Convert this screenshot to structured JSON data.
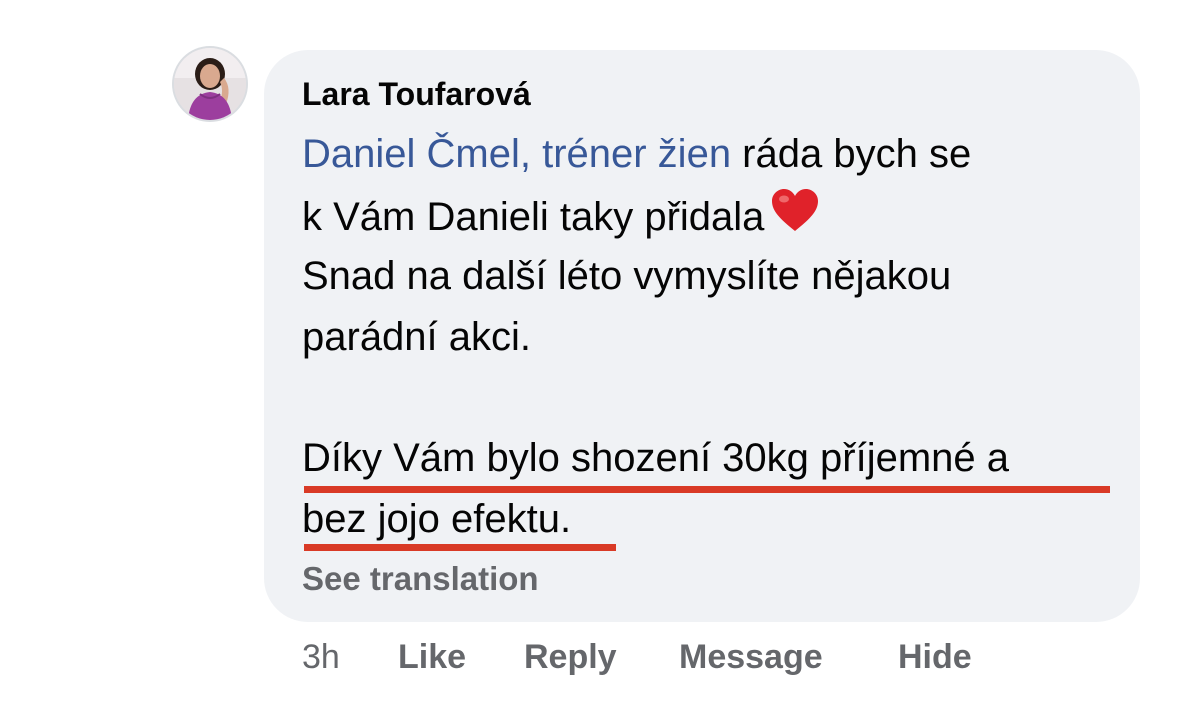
{
  "comment": {
    "author": "Lara Toufarová",
    "mention": "Daniel Čmel, tréner žien",
    "lines": [
      " ráda bych se",
      "k Vám Danieli taky přidala",
      "Snad na další léto vymyslíte nějakou",
      "parádní akci.",
      "Díky Vám bylo shození 30kg příjemné a",
      "bez jojo efektu."
    ],
    "emoji": "heart-emoji",
    "see_translation": "See translation"
  },
  "actions": {
    "time": "3h",
    "like": "Like",
    "reply": "Reply",
    "message": "Message",
    "hide": "Hide"
  },
  "colors": {
    "bubble": "#f0f2f5",
    "mention": "#385898",
    "underline": "#d93a26",
    "secondary_text": "#65676b"
  }
}
